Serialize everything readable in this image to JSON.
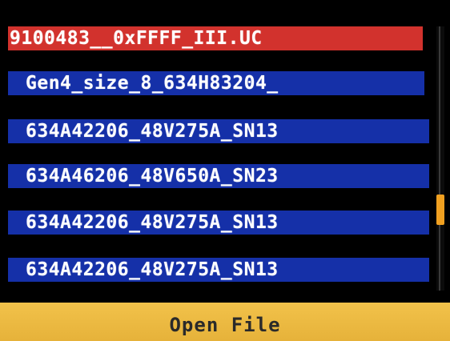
{
  "file_list": {
    "selected_index": 0,
    "items": [
      "9100483__0xFFFF_III.UC",
      "Gen4_size_8_634H83204_",
      "634A42206_48V275A_SN13",
      "634A46206_48V650A_SN23",
      "634A42206_48V275A_SN13",
      "634A42206_48V275A_SN13"
    ]
  },
  "scrollbar": {
    "position_fraction": 0.72,
    "thumb_color": "#f0a020"
  },
  "bottom_bar": {
    "action_label": "Open File"
  },
  "colors": {
    "selected_row": "#d2322d",
    "row": "#1530a8",
    "bottom_bar": "#f2c24a"
  }
}
